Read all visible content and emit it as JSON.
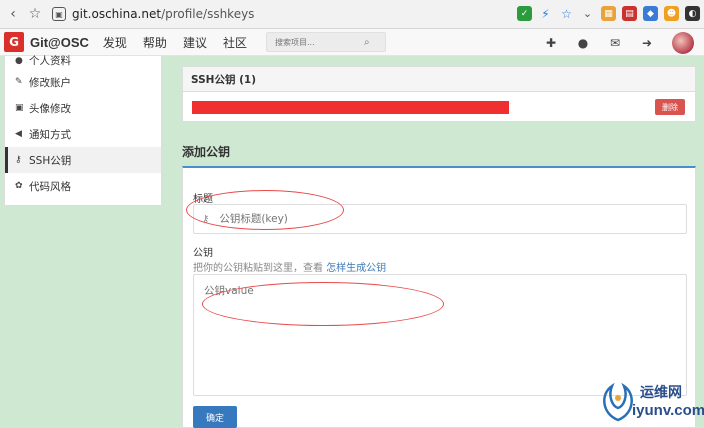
{
  "browser": {
    "url_host": "git.oschina.net",
    "url_path": "/profile/sshkeys",
    "back": "‹",
    "star": "☆"
  },
  "header": {
    "logo_mark": "G",
    "logo_text": "Git@OSC",
    "nav": [
      "发现",
      "帮助",
      "建议",
      "社区"
    ],
    "search_placeholder": "搜索项目..."
  },
  "sidebar": {
    "items": [
      {
        "label": "个人资料",
        "icon": "user-icon"
      },
      {
        "label": "修改账户",
        "icon": "pencil-icon"
      },
      {
        "label": "头像修改",
        "icon": "image-icon"
      },
      {
        "label": "通知方式",
        "icon": "volume-icon"
      },
      {
        "label": "SSH公钥",
        "icon": "key-icon"
      },
      {
        "label": "代码风格",
        "icon": "palette-icon"
      }
    ],
    "active_index": 4
  },
  "ssh_panel": {
    "title": "SSH公钥 (1)",
    "delete_label": "删除"
  },
  "add_section": {
    "title": "添加公钥",
    "title_label": "标题",
    "title_placeholder": "公钥标题(key)",
    "key_label": "公钥",
    "hint_prefix": "把你的公钥粘贴到这里，查看",
    "hint_link": "怎样生成公钥",
    "key_placeholder": "公钥value",
    "submit_label": "确定"
  },
  "watermark": {
    "line1": "运维网",
    "line2": "iyunv.com"
  },
  "colors": {
    "page_bg": "#cfe8d2",
    "logo_red": "#d9302c",
    "delete_red": "#d9534f",
    "primary_blue": "#3679be",
    "annotation_red": "#e84a4a"
  }
}
